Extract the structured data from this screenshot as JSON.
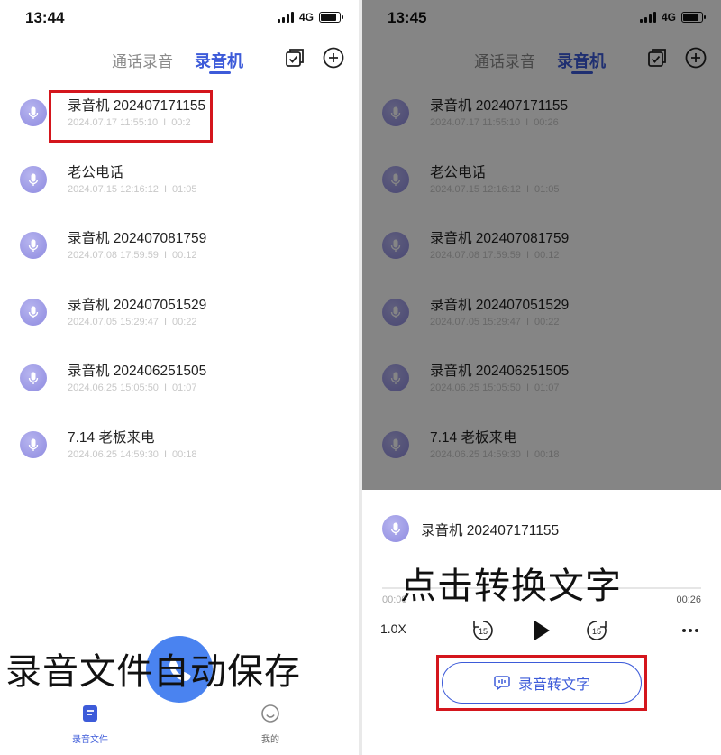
{
  "left": {
    "status": {
      "time": "13:44",
      "network": "4G"
    },
    "nav": {
      "tab_calls": "通话录音",
      "tab_recorder": "录音机"
    },
    "recordings": [
      {
        "title": "录音机 202407171155",
        "date": "2024.07.17 11:55:10",
        "duration": "00:2"
      },
      {
        "title": "老公电话",
        "date": "2024.07.15 12:16:12",
        "duration": "01:05"
      },
      {
        "title": "录音机 202407081759",
        "date": "2024.07.08 17:59:59",
        "duration": "00:12"
      },
      {
        "title": "录音机 202407051529",
        "date": "2024.07.05 15:29:47",
        "duration": "00:22"
      },
      {
        "title": "录音机 202406251505",
        "date": "2024.06.25 15:05:50",
        "duration": "01:07"
      },
      {
        "title": "7.14 老板来电",
        "date": "2024.06.25 14:59:30",
        "duration": "00:18"
      }
    ],
    "caption": "录音文件自动保存",
    "tabbar": {
      "files": "录音文件",
      "mine": "我的"
    }
  },
  "right": {
    "status": {
      "time": "13:45",
      "network": "4G"
    },
    "nav": {
      "tab_calls": "通话录音",
      "tab_recorder": "录音机"
    },
    "recordings": [
      {
        "title": "录音机 202407171155",
        "date": "2024.07.17 11:55:10",
        "duration": "00:26"
      },
      {
        "title": "老公电话",
        "date": "2024.07.15 12:16:12",
        "duration": "01:05"
      },
      {
        "title": "录音机 202407081759",
        "date": "2024.07.08 17:59:59",
        "duration": "00:12"
      },
      {
        "title": "录音机 202407051529",
        "date": "2024.07.05 15:29:47",
        "duration": "00:22"
      },
      {
        "title": "录音机 202406251505",
        "date": "2024.06.25 15:05:50",
        "duration": "01:07"
      },
      {
        "title": "7.14 老板来电",
        "date": "2024.06.25 14:59:30",
        "duration": "00:18"
      }
    ],
    "player": {
      "title": "录音机 202407171155",
      "caption": "点击转换文字",
      "time_start": "00:00",
      "time_end": "00:26",
      "speed": "1.0X",
      "skip_back": "15",
      "skip_forward": "15",
      "transcribe_label": "录音转文字"
    }
  },
  "colors": {
    "accent": "#3d5bd9",
    "highlight": "#d4161d",
    "mic": "#8e8ae0",
    "fab": "#4a83f0"
  }
}
